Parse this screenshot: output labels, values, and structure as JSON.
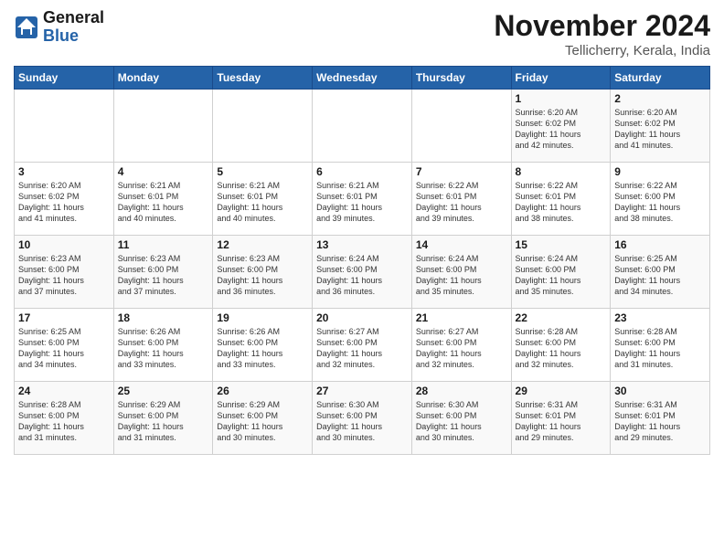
{
  "header": {
    "logo_general": "General",
    "logo_blue": "Blue",
    "month_title": "November 2024",
    "location": "Tellicherry, Kerala, India"
  },
  "days_of_week": [
    "Sunday",
    "Monday",
    "Tuesday",
    "Wednesday",
    "Thursday",
    "Friday",
    "Saturday"
  ],
  "weeks": [
    [
      {
        "day": "",
        "info": ""
      },
      {
        "day": "",
        "info": ""
      },
      {
        "day": "",
        "info": ""
      },
      {
        "day": "",
        "info": ""
      },
      {
        "day": "",
        "info": ""
      },
      {
        "day": "1",
        "info": "Sunrise: 6:20 AM\nSunset: 6:02 PM\nDaylight: 11 hours\nand 42 minutes."
      },
      {
        "day": "2",
        "info": "Sunrise: 6:20 AM\nSunset: 6:02 PM\nDaylight: 11 hours\nand 41 minutes."
      }
    ],
    [
      {
        "day": "3",
        "info": "Sunrise: 6:20 AM\nSunset: 6:02 PM\nDaylight: 11 hours\nand 41 minutes."
      },
      {
        "day": "4",
        "info": "Sunrise: 6:21 AM\nSunset: 6:01 PM\nDaylight: 11 hours\nand 40 minutes."
      },
      {
        "day": "5",
        "info": "Sunrise: 6:21 AM\nSunset: 6:01 PM\nDaylight: 11 hours\nand 40 minutes."
      },
      {
        "day": "6",
        "info": "Sunrise: 6:21 AM\nSunset: 6:01 PM\nDaylight: 11 hours\nand 39 minutes."
      },
      {
        "day": "7",
        "info": "Sunrise: 6:22 AM\nSunset: 6:01 PM\nDaylight: 11 hours\nand 39 minutes."
      },
      {
        "day": "8",
        "info": "Sunrise: 6:22 AM\nSunset: 6:01 PM\nDaylight: 11 hours\nand 38 minutes."
      },
      {
        "day": "9",
        "info": "Sunrise: 6:22 AM\nSunset: 6:00 PM\nDaylight: 11 hours\nand 38 minutes."
      }
    ],
    [
      {
        "day": "10",
        "info": "Sunrise: 6:23 AM\nSunset: 6:00 PM\nDaylight: 11 hours\nand 37 minutes."
      },
      {
        "day": "11",
        "info": "Sunrise: 6:23 AM\nSunset: 6:00 PM\nDaylight: 11 hours\nand 37 minutes."
      },
      {
        "day": "12",
        "info": "Sunrise: 6:23 AM\nSunset: 6:00 PM\nDaylight: 11 hours\nand 36 minutes."
      },
      {
        "day": "13",
        "info": "Sunrise: 6:24 AM\nSunset: 6:00 PM\nDaylight: 11 hours\nand 36 minutes."
      },
      {
        "day": "14",
        "info": "Sunrise: 6:24 AM\nSunset: 6:00 PM\nDaylight: 11 hours\nand 35 minutes."
      },
      {
        "day": "15",
        "info": "Sunrise: 6:24 AM\nSunset: 6:00 PM\nDaylight: 11 hours\nand 35 minutes."
      },
      {
        "day": "16",
        "info": "Sunrise: 6:25 AM\nSunset: 6:00 PM\nDaylight: 11 hours\nand 34 minutes."
      }
    ],
    [
      {
        "day": "17",
        "info": "Sunrise: 6:25 AM\nSunset: 6:00 PM\nDaylight: 11 hours\nand 34 minutes."
      },
      {
        "day": "18",
        "info": "Sunrise: 6:26 AM\nSunset: 6:00 PM\nDaylight: 11 hours\nand 33 minutes."
      },
      {
        "day": "19",
        "info": "Sunrise: 6:26 AM\nSunset: 6:00 PM\nDaylight: 11 hours\nand 33 minutes."
      },
      {
        "day": "20",
        "info": "Sunrise: 6:27 AM\nSunset: 6:00 PM\nDaylight: 11 hours\nand 32 minutes."
      },
      {
        "day": "21",
        "info": "Sunrise: 6:27 AM\nSunset: 6:00 PM\nDaylight: 11 hours\nand 32 minutes."
      },
      {
        "day": "22",
        "info": "Sunrise: 6:28 AM\nSunset: 6:00 PM\nDaylight: 11 hours\nand 32 minutes."
      },
      {
        "day": "23",
        "info": "Sunrise: 6:28 AM\nSunset: 6:00 PM\nDaylight: 11 hours\nand 31 minutes."
      }
    ],
    [
      {
        "day": "24",
        "info": "Sunrise: 6:28 AM\nSunset: 6:00 PM\nDaylight: 11 hours\nand 31 minutes."
      },
      {
        "day": "25",
        "info": "Sunrise: 6:29 AM\nSunset: 6:00 PM\nDaylight: 11 hours\nand 31 minutes."
      },
      {
        "day": "26",
        "info": "Sunrise: 6:29 AM\nSunset: 6:00 PM\nDaylight: 11 hours\nand 30 minutes."
      },
      {
        "day": "27",
        "info": "Sunrise: 6:30 AM\nSunset: 6:00 PM\nDaylight: 11 hours\nand 30 minutes."
      },
      {
        "day": "28",
        "info": "Sunrise: 6:30 AM\nSunset: 6:00 PM\nDaylight: 11 hours\nand 30 minutes."
      },
      {
        "day": "29",
        "info": "Sunrise: 6:31 AM\nSunset: 6:01 PM\nDaylight: 11 hours\nand 29 minutes."
      },
      {
        "day": "30",
        "info": "Sunrise: 6:31 AM\nSunset: 6:01 PM\nDaylight: 11 hours\nand 29 minutes."
      }
    ]
  ]
}
